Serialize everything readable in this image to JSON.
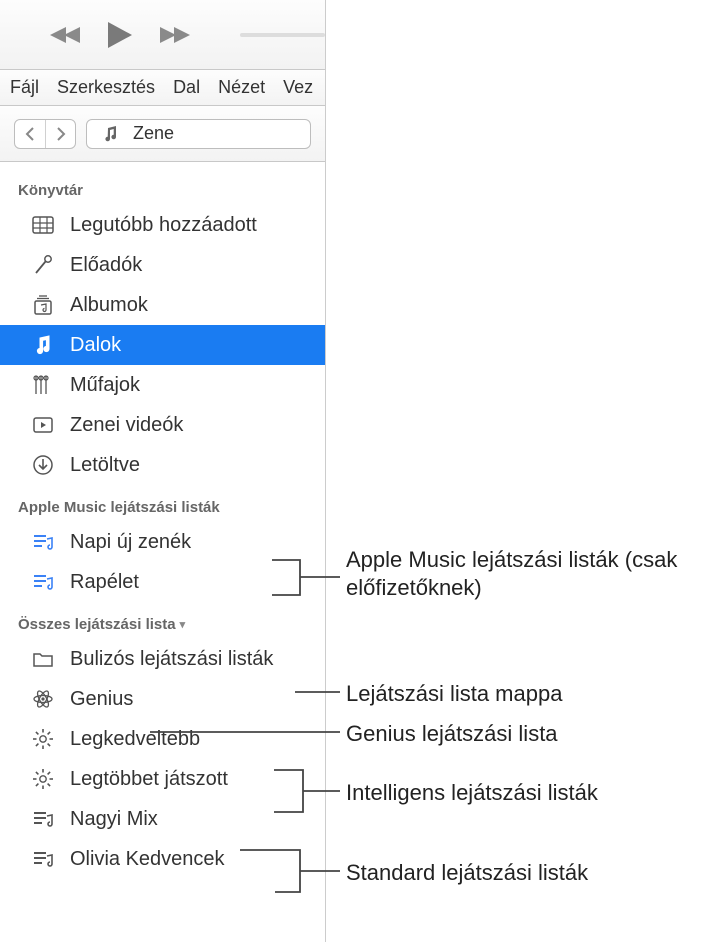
{
  "menubar": {
    "file": "Fájl",
    "edit": "Szerkesztés",
    "song": "Dal",
    "view": "Nézet",
    "controls_truncated": "Vez"
  },
  "nav": {
    "category": "Zene"
  },
  "sections": {
    "library": {
      "header": "Könyvtár"
    },
    "apple_music": {
      "header": "Apple Music lejátszási listák"
    },
    "all_playlists": {
      "header": "Összes lejátszási lista"
    }
  },
  "library_items": {
    "recently_added": "Legutóbb hozzáadott",
    "artists": "Előadók",
    "albums": "Albumok",
    "songs": "Dalok",
    "genres": "Műfajok",
    "music_videos": "Zenei videók",
    "downloaded": "Letöltve"
  },
  "apple_music_items": {
    "daily_new": "Napi új zenék",
    "rap_life": "Rapélet"
  },
  "playlist_items": {
    "party_folder": "Bulizós lejátszási listák",
    "genius": "Genius",
    "top_favorite": "Legkedveltebb",
    "most_played": "Legtöbbet játszott",
    "grandma_mix": "Nagyi Mix",
    "olivia_fav": "Olivia Kedvencek"
  },
  "callouts": {
    "apple_music": "Apple Music lejátszási listák (csak előfizetőknek)",
    "folder": "Lejátszási lista mappa",
    "genius": "Genius lejátszási lista",
    "smart": "Intelligens lejátszási listák",
    "standard": "Standard lejátszási listák"
  }
}
